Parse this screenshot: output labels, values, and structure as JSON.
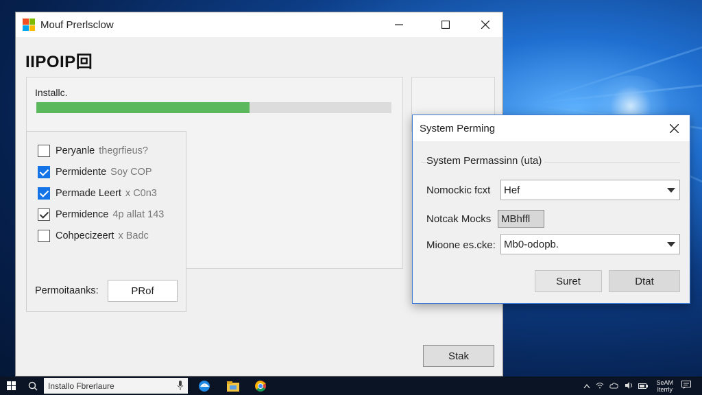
{
  "window": {
    "title": "Mouf Prerlsclow",
    "heading": "IIPOIP回",
    "install_label": "Installc.",
    "progress_percent": 60,
    "options": [
      {
        "label": "Peryanle",
        "sub": "thegrfieus?",
        "state": "unchecked"
      },
      {
        "label": "Permidente",
        "sub": "Soy COP",
        "state": "checked"
      },
      {
        "label": "Permade Leert",
        "sub": "x C0n3",
        "state": "checked"
      },
      {
        "label": "Permidence",
        "sub": "4p allat 143",
        "state": "tick"
      },
      {
        "label": "Cohpecizeert",
        "sub": "x Badc",
        "state": "unchecked"
      }
    ],
    "perm_label": "Permoitaanks:",
    "perm_value": "PRof",
    "start_button": "Stak"
  },
  "dialog": {
    "title": "System Perming",
    "group_title": "System Permassinn (uta)",
    "field1_label": "Nomockic fcxt",
    "field1_value": "Hef",
    "field2_label": "Notcak Mocks",
    "field2_value": "MBhffl",
    "field3_label": "Mioone es.cke:",
    "field3_value": "Mb0-odopb.",
    "button_cancel": "Suret",
    "button_ok": "Dtat"
  },
  "taskbar": {
    "search_text": "Installo Fbrerlaure",
    "clock_time": "SеАМ",
    "clock_date": "Iterrly"
  },
  "colors": {
    "progress": "#5cb85c",
    "checkbox_on": "#1473e6",
    "dialog_border": "#3b7bd6"
  }
}
